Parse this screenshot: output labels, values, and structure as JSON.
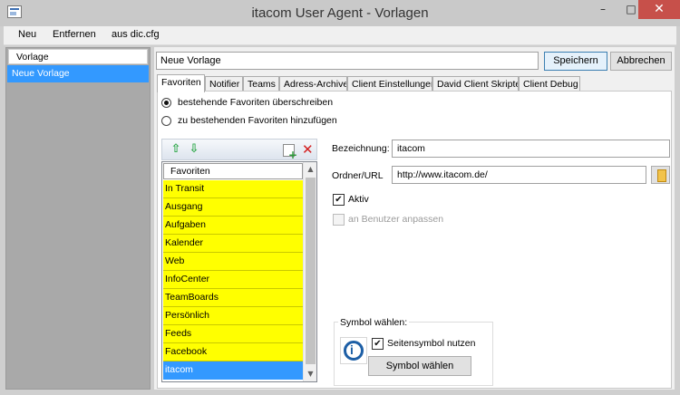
{
  "window": {
    "title": "itacom User Agent - Vorlagen",
    "minimize": "–",
    "maximize": "□",
    "close": "✕"
  },
  "menubar": {
    "items": [
      "Neu",
      "Entfernen",
      "aus dic.cfg"
    ]
  },
  "template_list": {
    "header": "Vorlage",
    "items": [
      "Neue Vorlage"
    ]
  },
  "editor": {
    "name_value": "Neue Vorlage",
    "save_label": "Speichern",
    "cancel_label": "Abbrechen",
    "tabs": [
      "Favoriten",
      "Notifier",
      "Teams",
      "Adress-Archive",
      "Client Einstellungen",
      "David Client Skripte",
      "Client Debug"
    ],
    "active_tab": "Favoriten"
  },
  "favorites_tab": {
    "radio_overwrite": "bestehende Favoriten überschreiben",
    "radio_append": "zu bestehenden Favoriten hinzufügen",
    "list_header": "Favoriten",
    "items": [
      "In Transit",
      "Ausgang",
      "Aufgaben",
      "Kalender",
      "Web",
      "InfoCenter",
      "TeamBoards",
      "Persönlich",
      "Feeds",
      "Facebook",
      "itacom"
    ],
    "selected_item": "itacom",
    "detail": {
      "label_name": "Bezeichnung:",
      "name_value": "itacom",
      "label_url": "Ordner/URL",
      "url_value": "http://www.itacom.de/",
      "active_label": "Aktiv",
      "active_checked": true,
      "user_adjust_label": "an Benutzer anpassen",
      "user_adjust_checked": false
    },
    "symbol": {
      "group_title": "Symbol wählen:",
      "use_page_symbol_label": "Seitensymbol nutzen",
      "use_page_symbol_checked": true,
      "choose_button": "Symbol wählen"
    }
  },
  "colors": {
    "selection": "#3399ff",
    "favorite_row": "#ffff00",
    "close_button": "#c7504a"
  }
}
